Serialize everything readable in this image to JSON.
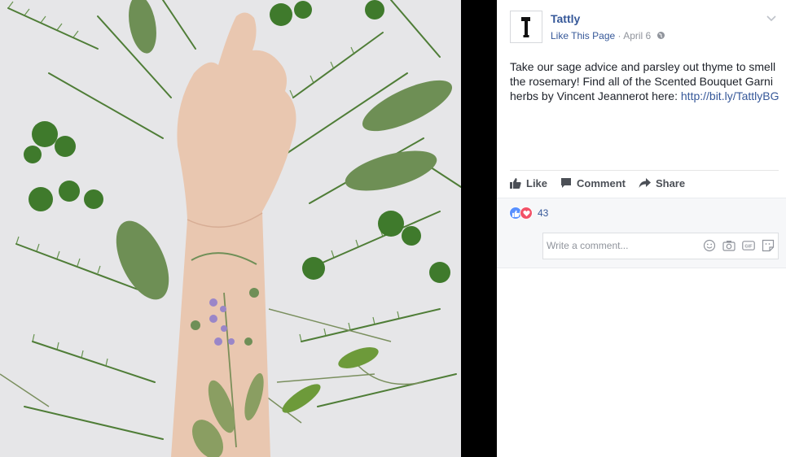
{
  "post": {
    "page_name": "Tattly",
    "like_page": "Like This Page",
    "separator": " · ",
    "date": "April 6",
    "body": "Take our sage advice and parsley out thyme to smell the rosemary! Find all of the Scented Bouquet Garni herbs by Vincent Jeannerot here: ",
    "link": "http://bit.ly/TattlyBG"
  },
  "actions": {
    "like": "Like",
    "comment": "Comment",
    "share": "Share"
  },
  "reactions": {
    "count": "43",
    "types": [
      "like",
      "love"
    ]
  },
  "comment_box": {
    "placeholder": "Write a comment...",
    "tools": [
      "emoji-icon",
      "camera-icon",
      "gif-icon",
      "sticker-icon"
    ]
  },
  "colors": {
    "link_blue": "#365899",
    "like_blue": "#5890ff",
    "love_red": "#f25268",
    "photo_background": "#e7e7e9",
    "herb_green": "#5c8a3e"
  }
}
